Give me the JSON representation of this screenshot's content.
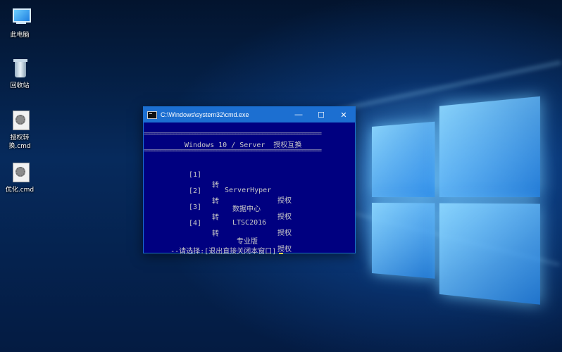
{
  "desktop": {
    "icons": [
      {
        "label": "此电脑",
        "icon": "computer-icon"
      },
      {
        "label": "回收站",
        "icon": "recycle-bin-icon"
      },
      {
        "label": "授权转换.cmd",
        "icon": "cmd-file-icon"
      },
      {
        "label": "优化.cmd",
        "icon": "cmd-file-icon"
      }
    ],
    "accent": "#1c6fd1"
  },
  "window": {
    "title": "C:\\Windows\\system32\\cmd.exe",
    "minimize": "—",
    "maximize": "☐",
    "close": "✕",
    "bg_color": "#000080"
  },
  "console": {
    "separator": "==================================================================",
    "heading": "Windows 10 / Server  授权互换",
    "options": [
      {
        "num": "[1]",
        "word": "转",
        "target": "ServerHyper",
        "suffix": "授权"
      },
      {
        "num": "[2]",
        "word": "转",
        "target": "数据中心",
        "suffix": "授权"
      },
      {
        "num": "[3]",
        "word": "转",
        "target": "LTSC2016",
        "suffix": "授权"
      },
      {
        "num": "[4]",
        "word": "转",
        "target": "专业版",
        "suffix": "授权"
      }
    ],
    "prompt": "--请选择:[退出直接关闭本窗口]"
  }
}
